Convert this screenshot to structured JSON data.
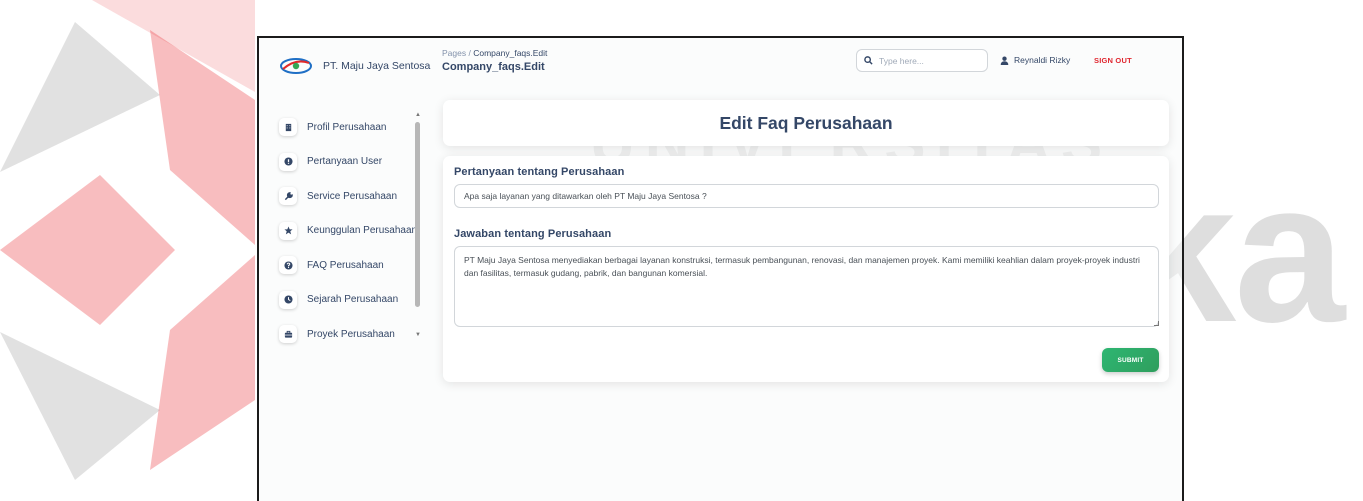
{
  "brand": {
    "name": "PT. Maju Jaya Sentosa",
    "logo_icon": "company-logo"
  },
  "header": {
    "breadcrumb_root": "Pages",
    "breadcrumb_sep": "/",
    "breadcrumb_current": "Company_faqs.Edit",
    "page_title": "Company_faqs.Edit",
    "search_placeholder": "Type here...",
    "user_name": "Reynaldi Rizky",
    "signout_label": "SIGN OUT"
  },
  "sidebar": {
    "items": [
      {
        "label": "Profil Perusahaan",
        "icon": "building-icon"
      },
      {
        "label": "Pertanyaan User",
        "icon": "question-circle-icon"
      },
      {
        "label": "Service Perusahaan",
        "icon": "wrench-icon"
      },
      {
        "label": "Keunggulan Perusahaan",
        "icon": "star-icon"
      },
      {
        "label": "FAQ Perusahaan",
        "icon": "question-icon"
      },
      {
        "label": "Sejarah Perusahaan",
        "icon": "history-icon"
      },
      {
        "label": "Proyek Perusahaan",
        "icon": "briefcase-icon"
      }
    ]
  },
  "main": {
    "card_title": "Edit Faq Perusahaan",
    "question_label": "Pertanyaan tentang Perusahaan",
    "question_value": "Apa saja layanan yang ditawarkan oleh PT Maju Jaya Sentosa ?",
    "answer_label": "Jawaban tentang Perusahaan",
    "answer_value": "PT Maju Jaya Sentosa menyediakan berbagai layanan konstruksi, termasuk pembangunan, renovasi, dan manajemen proyek. Kami memiliki keahlian dalam proyek-proyek industri dan fasilitas, termasuk gudang, pabrik, dan bangunan komersial.",
    "submit_label": "SUBMIT"
  },
  "watermark": {
    "line1": "UNIVERSITAS",
    "line2": "Dinamika"
  },
  "colors": {
    "watermark_red": "#e8252c",
    "submit_green": "#2eb672",
    "signout_red": "#e0262f",
    "text_dark": "#344767"
  }
}
